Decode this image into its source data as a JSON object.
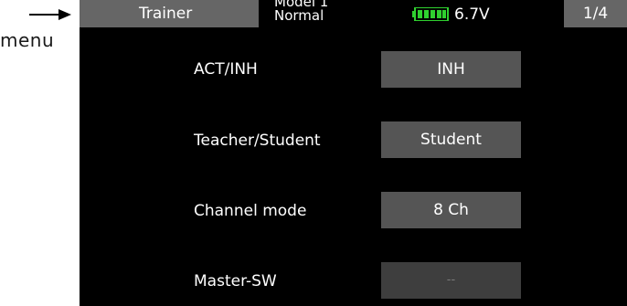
{
  "annotation": {
    "label": "menu"
  },
  "header": {
    "title": "Trainer",
    "model_line1": "Model 1",
    "model_line2": "Normal",
    "voltage": "6.7V",
    "page": "1/4",
    "battery_icon": "battery-icon",
    "battery_color": "#2fd12f"
  },
  "rows": [
    {
      "label": "ACT/INH",
      "value": "INH"
    },
    {
      "label": "Teacher/Student",
      "value": "Student"
    },
    {
      "label": "Channel mode",
      "value": "8 Ch"
    },
    {
      "label": "Master-SW",
      "value": "--"
    }
  ]
}
